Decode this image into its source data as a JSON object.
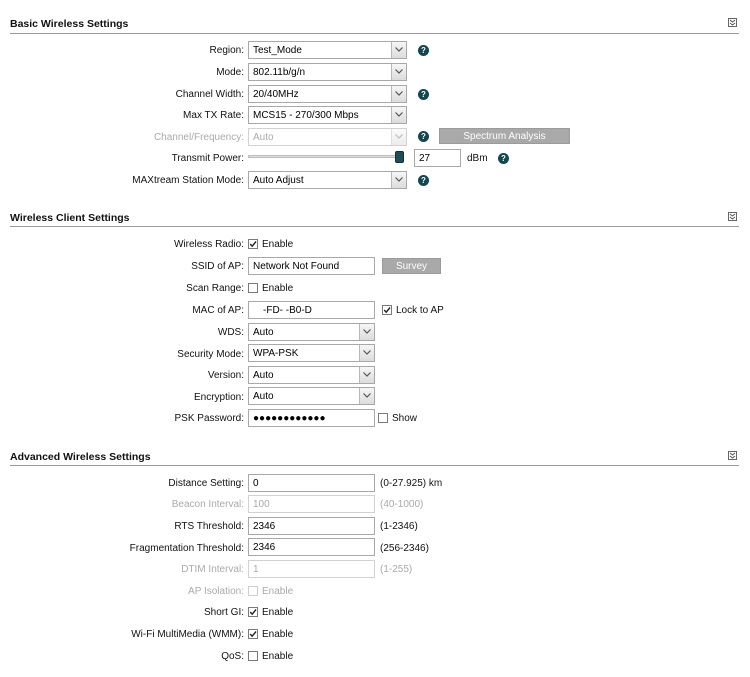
{
  "basic": {
    "title": "Basic Wireless Settings",
    "region": {
      "label": "Region:",
      "value": "Test_Mode"
    },
    "mode": {
      "label": "Mode:",
      "value": "802.11b/g/n"
    },
    "channel_width": {
      "label": "Channel Width:",
      "value": "20/40MHz"
    },
    "max_tx_rate": {
      "label": "Max TX Rate:",
      "value": "MCS15 - 270/300 Mbps"
    },
    "channel_frequency": {
      "label": "Channel/Frequency:",
      "value": "Auto"
    },
    "spectrum_button": "Spectrum Analysis",
    "transmit_power": {
      "label": "Transmit Power:",
      "value": "27",
      "unit": "dBm",
      "level": 1.0
    },
    "maxtream": {
      "label": "MAXtream Station Mode:",
      "value": "Auto Adjust"
    }
  },
  "client": {
    "title": "Wireless Client Settings",
    "wireless_radio": {
      "label": "Wireless Radio:",
      "checkbox_label": "Enable",
      "checked": true
    },
    "ssid": {
      "label": "SSID of AP:",
      "value": "Network Not Found"
    },
    "survey_button": "Survey",
    "scan_range": {
      "label": "Scan Range:",
      "checkbox_label": "Enable",
      "checked": false
    },
    "mac": {
      "label": "MAC of AP:",
      "value": "-FD-    -B0-D",
      "lock_label": "Lock to AP",
      "lock_checked": true
    },
    "wds": {
      "label": "WDS:",
      "value": "Auto"
    },
    "security_mode": {
      "label": "Security Mode:",
      "value": "WPA-PSK"
    },
    "version": {
      "label": "Version:",
      "value": "Auto"
    },
    "encryption": {
      "label": "Encryption:",
      "value": "Auto"
    },
    "psk": {
      "label": "PSK Password:",
      "value": "●●●●●●●●●●●●",
      "show_label": "Show",
      "show_checked": false
    }
  },
  "advanced": {
    "title": "Advanced Wireless Settings",
    "distance": {
      "label": "Distance Setting:",
      "value": "0",
      "range": "(0-27.925) km"
    },
    "beacon": {
      "label": "Beacon Interval:",
      "value": "100",
      "range": "(40-1000)"
    },
    "rts": {
      "label": "RTS Threshold:",
      "value": "2346",
      "range": "(1-2346)"
    },
    "fragmentation": {
      "label": "Fragmentation Threshold:",
      "value": "2346",
      "range": "(256-2346)"
    },
    "dtim": {
      "label": "DTIM Interval:",
      "value": "1",
      "range": "(1-255)"
    },
    "ap_isolation": {
      "label": "AP Isolation:",
      "checkbox_label": "Enable",
      "checked": false
    },
    "short_gi": {
      "label": "Short GI:",
      "checkbox_label": "Enable",
      "checked": true
    },
    "wmm": {
      "label": "Wi-Fi MultiMedia (WMM):",
      "checkbox_label": "Enable",
      "checked": true
    },
    "qos": {
      "label": "QoS:",
      "checkbox_label": "Enable",
      "checked": false
    }
  },
  "icons": {
    "help": "question-mark-icon",
    "collapse": "chevron-double-down-icon",
    "select_arrow": "chevron-down-icon",
    "check": "checkmark-icon"
  },
  "colors": {
    "help_icon": "#15464f",
    "button_gray": "#a9a9a9",
    "slider_handle": "#1d4d57"
  }
}
